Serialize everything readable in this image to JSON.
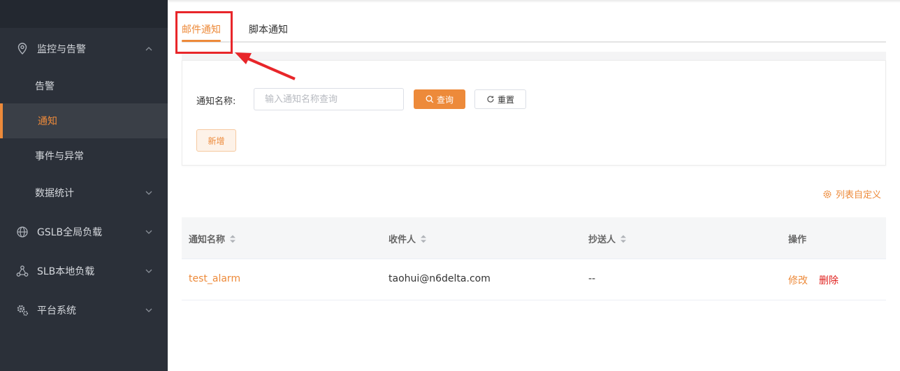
{
  "sidebar": {
    "items": [
      {
        "label": "监控与告警",
        "icon": "location-pin-icon",
        "expanded": true
      },
      {
        "label": "告警"
      },
      {
        "label": "通知",
        "active": true
      },
      {
        "label": "事件与异常"
      },
      {
        "label": "数据统计"
      },
      {
        "label": "GSLB全局负载",
        "icon": "globe-icon"
      },
      {
        "label": "SLB本地负载",
        "icon": "network-nodes-icon"
      },
      {
        "label": "平台系统",
        "icon": "gears-icon"
      }
    ]
  },
  "tabs": [
    {
      "label": "邮件通知",
      "active": true
    },
    {
      "label": "脚本通知"
    }
  ],
  "filter": {
    "label": "通知名称:",
    "placeholder": "输入通知名称查询",
    "query_label": "查询",
    "reset_label": "重置",
    "add_label": "新增"
  },
  "customize_label": "列表自定义",
  "table": {
    "columns": [
      "通知名称",
      "收件人",
      "抄送人",
      "操作"
    ],
    "rows": [
      {
        "name": "test_alarm",
        "recipient": "taohui@n6delta.com",
        "cc": "--",
        "edit": "修改",
        "delete": "删除"
      }
    ]
  },
  "colors": {
    "accent": "#ed8a3a",
    "sidebar_bg": "#2b3039",
    "danger": "#e0201d",
    "annotation": "#e8262a"
  }
}
